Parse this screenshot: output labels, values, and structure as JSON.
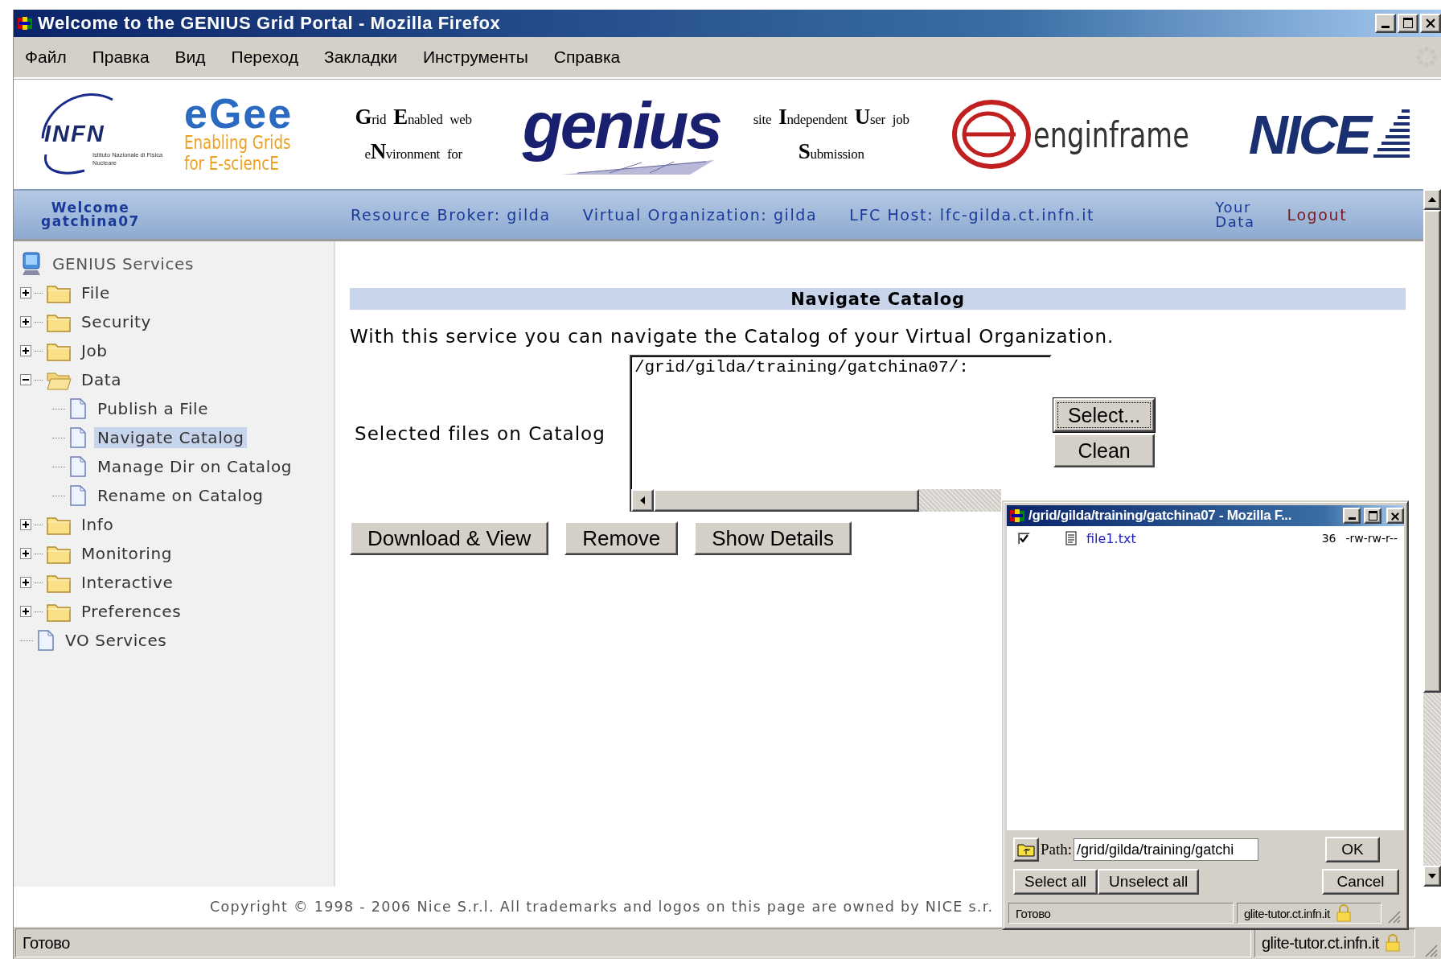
{
  "window": {
    "title": "Welcome to the GENIUS Grid Portal - Mozilla Firefox"
  },
  "menu": [
    "Файл",
    "Правка",
    "Вид",
    "Переход",
    "Закладки",
    "Инструменты",
    "Справка"
  ],
  "banner": {
    "infn": {
      "name": "INFN",
      "subtitle": "Istituto Nazionale di Fisica Nucleare"
    },
    "egee": {
      "name": "eGee",
      "line1": "Enabling Grids",
      "line2": "for E-sciencE"
    },
    "genius_acronym": [
      "**G**rid **E**nabled web",
      "e**N**vironment for"
    ],
    "genius": "genius",
    "siu_acronym": [
      "site **I**ndependent **U**ser job",
      "**S**ubmission"
    ],
    "enginframe": "enginframe",
    "nice": "NICE"
  },
  "navbar": {
    "welcome": "Welcome gatchina07",
    "resource_broker": "Resource Broker: gilda",
    "virtual_organization": "Virtual Organization: gilda",
    "lfc_host": "LFC Host: lfc-gilda.ct.infn.it",
    "your_data": "Your Data",
    "logout": "Logout"
  },
  "tree": {
    "root": "GENIUS Services",
    "items": [
      {
        "label": "File",
        "kind": "folder",
        "expanded": false,
        "selected": false
      },
      {
        "label": "Security",
        "kind": "folder",
        "expanded": false,
        "selected": false
      },
      {
        "label": "Job",
        "kind": "folder",
        "expanded": false,
        "selected": false
      },
      {
        "label": "Data",
        "kind": "folder",
        "expanded": true,
        "selected": false,
        "children": [
          {
            "label": "Publish a File",
            "kind": "page",
            "selected": false
          },
          {
            "label": "Navigate Catalog",
            "kind": "page",
            "selected": true
          },
          {
            "label": "Manage Dir on Catalog",
            "kind": "page",
            "selected": false
          },
          {
            "label": "Rename on Catalog",
            "kind": "page",
            "selected": false
          }
        ]
      },
      {
        "label": "Info",
        "kind": "folder",
        "expanded": false,
        "selected": false
      },
      {
        "label": "Monitoring",
        "kind": "folder",
        "expanded": false,
        "selected": false
      },
      {
        "label": "Interactive",
        "kind": "folder",
        "expanded": false,
        "selected": false
      },
      {
        "label": "Preferences",
        "kind": "folder",
        "expanded": false,
        "selected": false
      },
      {
        "label": "VO Services",
        "kind": "page",
        "selected": false
      }
    ]
  },
  "main": {
    "title": "Navigate Catalog",
    "description": "With this service you can navigate the Catalog of your Virtual Organization.",
    "field_label": "Selected files on Catalog",
    "field_value": "/grid/gilda/training/gatchina07/:",
    "side_buttons": [
      "Select...",
      "Clean"
    ],
    "actions": [
      "Download & View",
      "Remove",
      "Show Details"
    ]
  },
  "footer": "Copyright © 1998 - 2006 Nice S.r.l. All trademarks and logos on this page are owned by NICE s.r.",
  "status_bar": {
    "text": "Готово",
    "host": "glite-tutor.ct.infn.it"
  },
  "popup": {
    "title": "/grid/gilda/training/gatchina07 - Mozilla F...",
    "files": [
      {
        "name": "file1.txt",
        "checked": true,
        "size": "36",
        "permissions": "-rw-rw-r--"
      }
    ],
    "path_label": "Path:",
    "path_value": "/grid/gilda/training/gatchi",
    "ok": "OK",
    "select_all": "Select all",
    "unselect_all": "Unselect all",
    "cancel": "Cancel",
    "status": {
      "text": "Готово",
      "host": "glite-tutor.ct.infn.it"
    }
  }
}
